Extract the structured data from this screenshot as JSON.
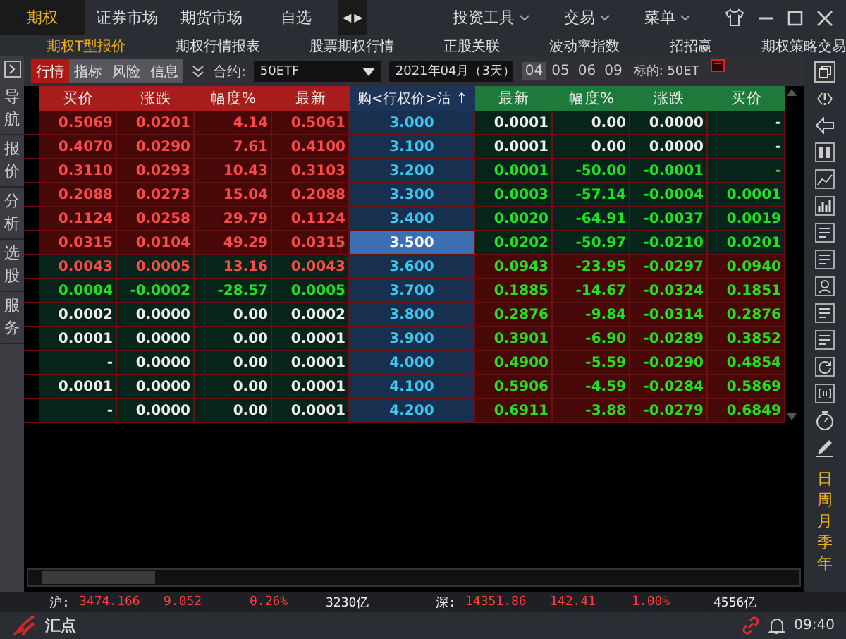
{
  "top_tabs": [
    {
      "label": "期权",
      "selected": true
    },
    {
      "label": "证券市场",
      "selected": false
    },
    {
      "label": "期货市场",
      "selected": false
    },
    {
      "label": "自选",
      "selected": false
    }
  ],
  "scroll_arrows": [
    "◀",
    "▶"
  ],
  "menus": [
    "投资工具",
    "交易",
    "菜单"
  ],
  "sub_tabs": [
    {
      "label": "期权T型报价",
      "selected": true
    },
    {
      "label": "期权行情报表",
      "selected": false
    },
    {
      "label": "股票期权行情",
      "selected": false
    },
    {
      "label": "正股关联",
      "selected": false
    },
    {
      "label": "波动率指数",
      "selected": false
    },
    {
      "label": "招招赢",
      "selected": false
    },
    {
      "label": "期权策略交易",
      "selected": false
    }
  ],
  "side_nav": [
    "导航",
    "报价",
    "分析",
    "选股",
    "服务"
  ],
  "toolbar": {
    "view_tabs": [
      {
        "label": "行情",
        "selected": true
      },
      {
        "label": "指标",
        "selected": false
      },
      {
        "label": "风险",
        "selected": false
      },
      {
        "label": "信息",
        "selected": false
      }
    ],
    "contract_label": "合约:",
    "contract": "50ETF",
    "expiry": "2021年04月（3天）",
    "months": [
      {
        "label": "04",
        "selected": true
      },
      {
        "label": "05",
        "selected": false
      },
      {
        "label": "06",
        "selected": false
      },
      {
        "label": "09",
        "selected": false
      }
    ],
    "underlying": "标的: 50ET"
  },
  "table": {
    "call_columns": [
      "买价",
      "涨跌",
      "幅度%",
      "最新"
    ],
    "strike_column": "购<行权价>沽 ↑",
    "put_columns": [
      "最新",
      "幅度%",
      "涨跌",
      "买价"
    ],
    "rows": [
      {
        "strike": "3.000",
        "selected": false,
        "call": {
          "itm": true,
          "color": "#ff4a4a",
          "cells": [
            "0.5069",
            "0.0201",
            "4.14",
            "0.5061"
          ]
        },
        "put": {
          "itm": false,
          "color": "#eeeeee",
          "cells": [
            "0.0001",
            "0.00",
            "0.0000",
            "-"
          ]
        }
      },
      {
        "strike": "3.100",
        "selected": false,
        "call": {
          "itm": true,
          "color": "#ff4a4a",
          "cells": [
            "0.4070",
            "0.0290",
            "7.61",
            "0.4100"
          ]
        },
        "put": {
          "itm": false,
          "color": "#eeeeee",
          "cells": [
            "0.0001",
            "0.00",
            "0.0000",
            "-"
          ]
        }
      },
      {
        "strike": "3.200",
        "selected": false,
        "call": {
          "itm": true,
          "color": "#ff4a4a",
          "cells": [
            "0.3110",
            "0.0293",
            "10.43",
            "0.3103"
          ]
        },
        "put": {
          "itm": false,
          "color": "#22e022",
          "cells": [
            "0.0001",
            "-50.00",
            "-0.0001",
            "-"
          ]
        }
      },
      {
        "strike": "3.300",
        "selected": false,
        "call": {
          "itm": true,
          "color": "#ff4a4a",
          "cells": [
            "0.2088",
            "0.0273",
            "15.04",
            "0.2088"
          ]
        },
        "put": {
          "itm": false,
          "color": "#22e022",
          "cells": [
            "0.0003",
            "-57.14",
            "-0.0004",
            "0.0001"
          ]
        }
      },
      {
        "strike": "3.400",
        "selected": false,
        "call": {
          "itm": true,
          "color": "#ff4a4a",
          "cells": [
            "0.1124",
            "0.0258",
            "29.79",
            "0.1124"
          ]
        },
        "put": {
          "itm": false,
          "color": "#22e022",
          "cells": [
            "0.0020",
            "-64.91",
            "-0.0037",
            "0.0019"
          ]
        }
      },
      {
        "strike": "3.500",
        "selected": true,
        "call": {
          "itm": true,
          "color": "#ff4a4a",
          "cells": [
            "0.0315",
            "0.0104",
            "49.29",
            "0.0315"
          ]
        },
        "put": {
          "itm": false,
          "color": "#22e022",
          "cells": [
            "0.0202",
            "-50.97",
            "-0.0210",
            "0.0201"
          ]
        }
      },
      {
        "strike": "3.600",
        "selected": false,
        "call": {
          "itm": false,
          "color": "#ff4a4a",
          "cells": [
            "0.0043",
            "0.0005",
            "13.16",
            "0.0043"
          ]
        },
        "put": {
          "itm": true,
          "color": "#22e022",
          "cells": [
            "0.0943",
            "-23.95",
            "-0.0297",
            "0.0940"
          ]
        }
      },
      {
        "strike": "3.700",
        "selected": false,
        "call": {
          "itm": false,
          "color": "#22e022",
          "cells": [
            "0.0004",
            "-0.0002",
            "-28.57",
            "0.0005"
          ]
        },
        "put": {
          "itm": true,
          "color": "#22e022",
          "cells": [
            "0.1885",
            "-14.67",
            "-0.0324",
            "0.1851"
          ]
        }
      },
      {
        "strike": "3.800",
        "selected": false,
        "call": {
          "itm": false,
          "color": "#eeeeee",
          "cells": [
            "0.0002",
            "0.0000",
            "0.00",
            "0.0002"
          ]
        },
        "put": {
          "itm": true,
          "color": "#22e022",
          "cells": [
            "0.2876",
            "-9.84",
            "-0.0314",
            "0.2876"
          ]
        }
      },
      {
        "strike": "3.900",
        "selected": false,
        "call": {
          "itm": false,
          "color": "#eeeeee",
          "cells": [
            "0.0001",
            "0.0000",
            "0.00",
            "0.0001"
          ]
        },
        "put": {
          "itm": true,
          "color": "#22e022",
          "cells": [
            "0.3901",
            "-6.90",
            "-0.0289",
            "0.3852"
          ]
        }
      },
      {
        "strike": "4.000",
        "selected": false,
        "call": {
          "itm": false,
          "color": "#eeeeee",
          "cells": [
            "-",
            "0.0000",
            "0.00",
            "0.0001"
          ]
        },
        "put": {
          "itm": true,
          "color": "#22e022",
          "cells": [
            "0.4900",
            "-5.59",
            "-0.0290",
            "0.4854"
          ]
        }
      },
      {
        "strike": "4.100",
        "selected": false,
        "call": {
          "itm": false,
          "color": "#eeeeee",
          "cells": [
            "0.0001",
            "0.0000",
            "0.00",
            "0.0001"
          ]
        },
        "put": {
          "itm": true,
          "color": "#22e022",
          "cells": [
            "0.5906",
            "-4.59",
            "-0.0284",
            "0.5869"
          ]
        }
      },
      {
        "strike": "4.200",
        "selected": false,
        "call": {
          "itm": false,
          "color": "#eeeeee",
          "cells": [
            "-",
            "0.0000",
            "0.00",
            "0.0001"
          ]
        },
        "put": {
          "itm": true,
          "color": "#22e022",
          "cells": [
            "0.6911",
            "-3.88",
            "-0.0279",
            "0.6849"
          ]
        }
      }
    ]
  },
  "periods": [
    "日",
    "周",
    "月",
    "季",
    "年"
  ],
  "index_bar": [
    {
      "label": "沪:",
      "color": "#eeeeee"
    },
    {
      "label": "3474.166",
      "color": "#ff4040"
    },
    {
      "label": "9.052",
      "color": "#ff4040"
    },
    {
      "label": "0.26%",
      "color": "#ff4040"
    },
    {
      "label": "3230亿",
      "color": "#eeeeee"
    },
    {
      "label": "深:",
      "color": "#eeeeee"
    },
    {
      "label": "14351.86",
      "color": "#ff4040"
    },
    {
      "label": "142.41",
      "color": "#ff4040"
    },
    {
      "label": "1.00%",
      "color": "#ff4040"
    },
    {
      "label": "4556亿",
      "color": "#eeeeee"
    }
  ],
  "footer": {
    "brand": "汇点",
    "time": "09:40"
  }
}
